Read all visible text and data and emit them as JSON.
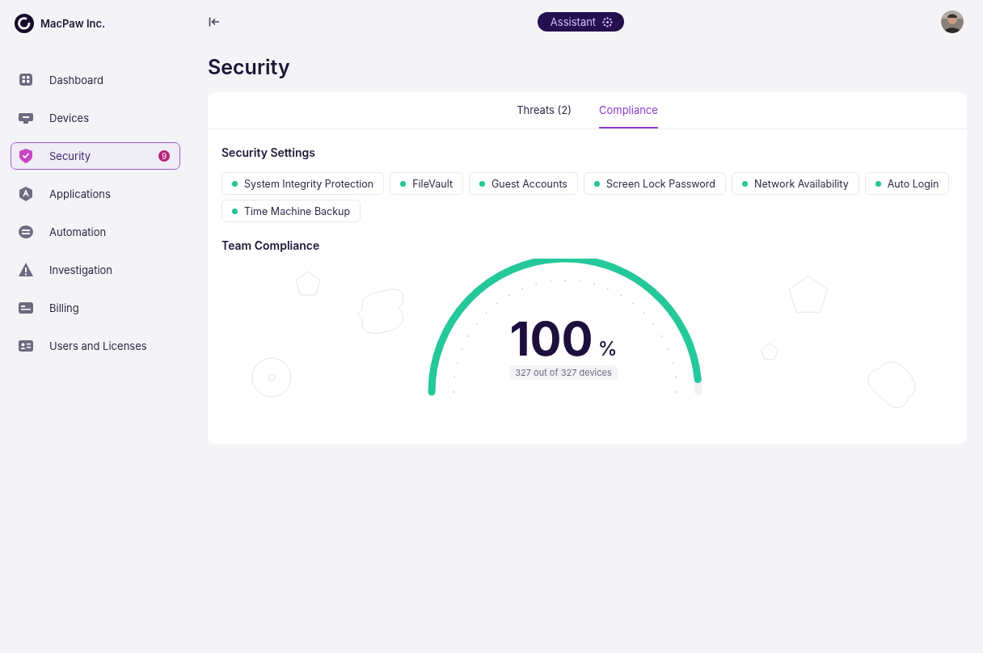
{
  "org": {
    "name": "MacPaw Inc."
  },
  "sidebar": {
    "items": [
      {
        "label": "Dashboard",
        "selected": false
      },
      {
        "label": "Devices",
        "selected": false
      },
      {
        "label": "Security",
        "selected": true,
        "badge": "9"
      },
      {
        "label": "Applications",
        "selected": false
      },
      {
        "label": "Automation",
        "selected": false
      },
      {
        "label": "Investigation",
        "selected": false
      },
      {
        "label": "Billing",
        "selected": false
      },
      {
        "label": "Users and Licenses",
        "selected": false
      }
    ]
  },
  "topbar": {
    "assistant": "Assistant"
  },
  "page": {
    "title": "Security"
  },
  "tabs": [
    {
      "label": "Threats (2)",
      "selected": false
    },
    {
      "label": "Compliance",
      "selected": true
    }
  ],
  "security_settings": {
    "title": "Security Settings",
    "items": [
      "System Integrity Protection",
      "FileVault",
      "Guest Accounts",
      "Screen Lock Password",
      "Network Availability",
      "Auto Login",
      "Time Machine Backup"
    ]
  },
  "team_compliance": {
    "title": "Team Compliance",
    "value": "100",
    "unit": "%",
    "caption": "327 out of 327 devices",
    "level": 0.97
  }
}
